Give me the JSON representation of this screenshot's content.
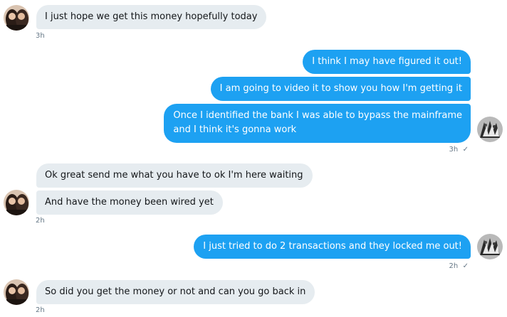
{
  "messages": [
    {
      "text": "I just hope we get this money hopefully today"
    },
    {
      "text": "I think I may have figured it out!"
    },
    {
      "text": "I am going to video it to show you how I'm getting it"
    },
    {
      "line1": "Once I identified the bank I was able to bypass the mainframe",
      "line2": "and I think it's gonna work"
    },
    {
      "text": "Ok great send me what you have to ok I'm here waiting"
    },
    {
      "text": "And have the money been wired yet"
    },
    {
      "text": "I just tried to do 2 transactions and they locked me out!"
    },
    {
      "text": "So did you get the money or not and can you go back in"
    }
  ],
  "timestamps": {
    "t1": "3h",
    "t2": "3h",
    "t3": "2h",
    "t4": "2h",
    "t5": "2h"
  },
  "read_mark": "✓",
  "icons": {
    "contact_avatar": "contact-avatar",
    "self_avatar": "self-avatar",
    "read_check": "check-icon"
  },
  "colors": {
    "incoming_bubble": "#e6ecf0",
    "outgoing_bubble": "#1da1f2",
    "meta_text": "#657786"
  }
}
